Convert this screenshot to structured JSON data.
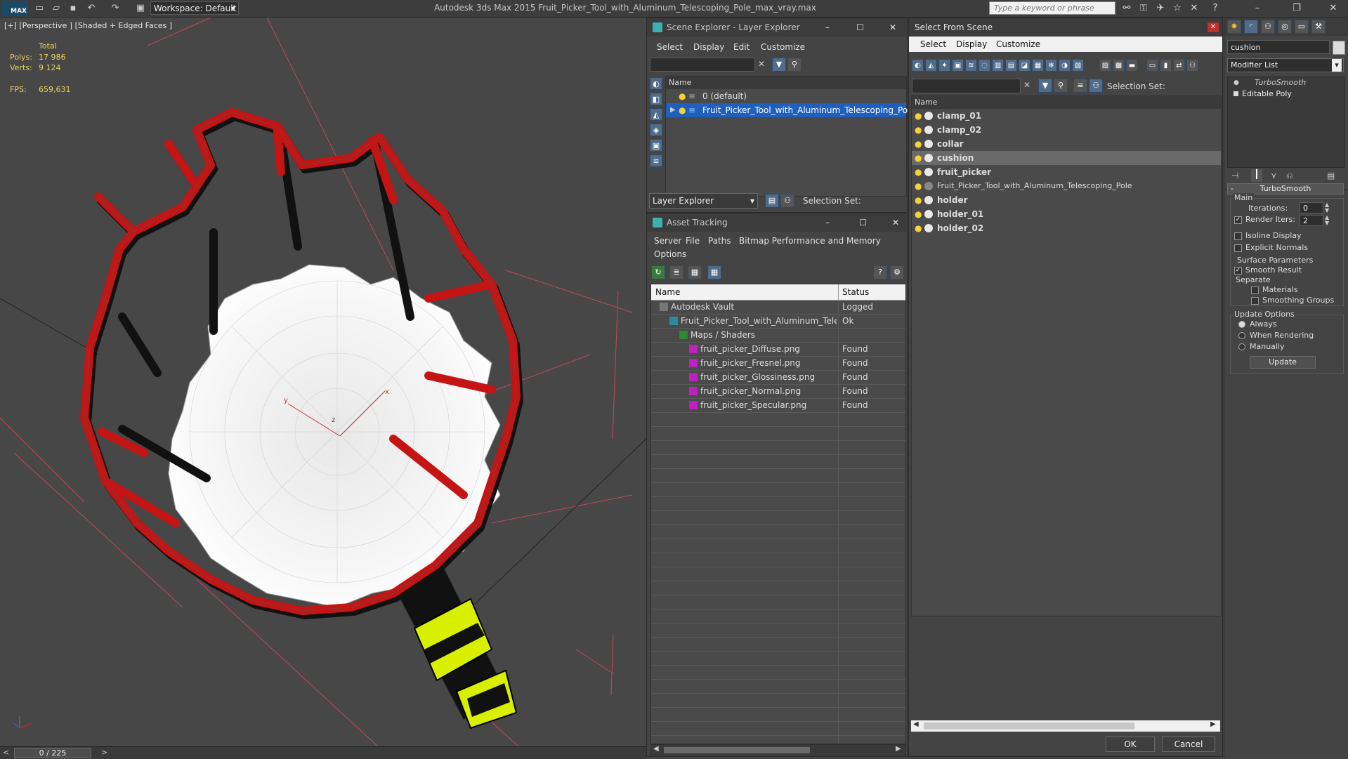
{
  "titlebar": {
    "workspace_label": "Workspace: Default",
    "window_title": "Autodesk 3ds Max  2015     Fruit_Picker_Tool_with_Aluminum_Telescoping_Pole_max_vray.max",
    "search_placeholder": "Type a keyword or phrase",
    "logo_text": "MAX"
  },
  "viewport": {
    "label": "[+] [Perspective ] [Shaded + Edged Faces ]",
    "stats": {
      "total_label": "Total",
      "polys_label": "Polys:",
      "polys_value": "17 986",
      "verts_label": "Verts:",
      "verts_value": "9 124",
      "fps_label": "FPS:",
      "fps_value": "659,631"
    },
    "time_slider": "0 / 225",
    "gizmo_labels": {
      "x": "x",
      "y": "y",
      "z": "z"
    }
  },
  "scene_explorer": {
    "title": "Scene Explorer - Layer Explorer",
    "menu": [
      "Select",
      "Display",
      "Edit",
      "Customize"
    ],
    "column_name": "Name",
    "layers": [
      {
        "label": "0 (default)",
        "selected": false
      },
      {
        "label": "Fruit_Picker_Tool_with_Aluminum_Telescoping_Pole",
        "selected": true
      }
    ],
    "footer_dropdown": "Layer Explorer",
    "selection_set_label": "Selection Set:"
  },
  "asset_tracking": {
    "title": "Asset Tracking",
    "menu": [
      "Server",
      "File",
      "Paths",
      "Bitmap Performance and Memory",
      "Options"
    ],
    "columns": {
      "name": "Name",
      "status": "Status"
    },
    "rows": [
      {
        "name": "Autodesk Vault",
        "status": "Logged",
        "indent": 0,
        "icon": "vault-icon"
      },
      {
        "name": "Fruit_Picker_Tool_with_Aluminum_Telescoping_...",
        "status": "Ok",
        "indent": 1,
        "icon": "max-file-icon"
      },
      {
        "name": "Maps / Shaders",
        "status": "",
        "indent": 2,
        "icon": "maps-icon"
      },
      {
        "name": "fruit_picker_Diffuse.png",
        "status": "Found",
        "indent": 3,
        "icon": "png-icon"
      },
      {
        "name": "fruit_picker_Fresnel.png",
        "status": "Found",
        "indent": 3,
        "icon": "png-icon"
      },
      {
        "name": "fruit_picker_Glossiness.png",
        "status": "Found",
        "indent": 3,
        "icon": "png-icon"
      },
      {
        "name": "fruit_picker_Normal.png",
        "status": "Found",
        "indent": 3,
        "icon": "png-icon"
      },
      {
        "name": "fruit_picker_Specular.png",
        "status": "Found",
        "indent": 3,
        "icon": "png-icon"
      }
    ]
  },
  "select_from_scene": {
    "title": "Select From Scene",
    "menu": [
      "Select",
      "Display",
      "Customize"
    ],
    "selection_set_label": "Selection Set:",
    "column_name": "Name",
    "objects": [
      {
        "label": "clamp_01",
        "bold": true,
        "selected": false
      },
      {
        "label": "clamp_02",
        "bold": true,
        "selected": false
      },
      {
        "label": "collar",
        "bold": true,
        "selected": false
      },
      {
        "label": "cushion",
        "bold": true,
        "selected": true
      },
      {
        "label": "fruit_picker",
        "bold": true,
        "selected": false
      },
      {
        "label": "Fruit_Picker_Tool_with_Aluminum_Telescoping_Pole",
        "bold": false,
        "selected": false
      },
      {
        "label": "holder",
        "bold": true,
        "selected": false
      },
      {
        "label": "holder_01",
        "bold": true,
        "selected": false
      },
      {
        "label": "holder_02",
        "bold": true,
        "selected": false
      }
    ],
    "ok_label": "OK",
    "cancel_label": "Cancel"
  },
  "command_panel": {
    "object_name": "cushion",
    "modifier_list_label": "Modifier List",
    "stack": [
      "TurboSmooth",
      "Editable Poly"
    ],
    "rollout_title": "TurboSmooth",
    "main_label": "Main",
    "iterations_label": "Iterations:",
    "iterations_value": "0",
    "render_iters_label": "Render Iters:",
    "render_iters_value": "2",
    "render_iters_checked": true,
    "isoline_label": "Isoline Display",
    "explicit_normals_label": "Explicit Normals",
    "surface_params_label": "Surface Parameters",
    "smooth_result_label": "Smooth Result",
    "smooth_result_checked": true,
    "separate_label": "Separate",
    "materials_label": "Materials",
    "smoothing_groups_label": "Smoothing Groups",
    "update_options_label": "Update Options",
    "always_label": "Always",
    "when_rendering_label": "When Rendering",
    "manually_label": "Manually",
    "update_button": "Update"
  },
  "colors": {
    "selection_blue": "#1f5fbf",
    "frame_red": "#c41414",
    "grip_yellow": "#d8f000",
    "stat_yellow": "#e5d35a"
  }
}
